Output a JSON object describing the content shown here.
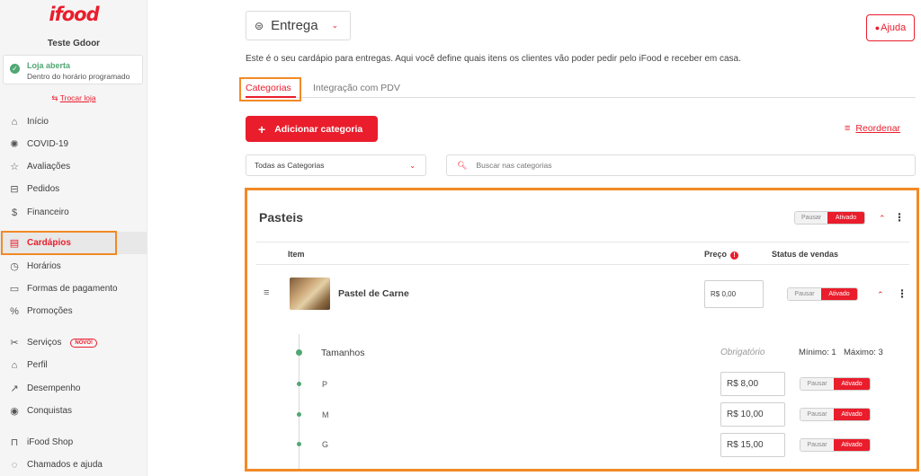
{
  "sidebar": {
    "brand": "ifood",
    "store_name": "Teste Gdoor",
    "status": {
      "title": "Loja aberta",
      "subtitle": "Dentro do horário programado",
      "color": "#50a773"
    },
    "switch_store": "Trocar loja",
    "items": [
      {
        "label": "Início",
        "icon": "home-icon"
      },
      {
        "label": "COVID-19",
        "icon": "virus-icon"
      },
      {
        "label": "Avaliações",
        "icon": "star-icon"
      },
      {
        "label": "Pedidos",
        "icon": "orders-icon"
      },
      {
        "label": "Financeiro",
        "icon": "dollar-icon"
      },
      {
        "label": "Cardápios",
        "icon": "menu-book-icon",
        "active": true
      },
      {
        "label": "Horários",
        "icon": "clock-icon"
      },
      {
        "label": "Formas de pagamento",
        "icon": "card-icon"
      },
      {
        "label": "Promoções",
        "icon": "percent-icon"
      },
      {
        "label": "Serviços",
        "icon": "services-icon",
        "badge": "NOVO!"
      },
      {
        "label": "Perfil",
        "icon": "store-icon"
      },
      {
        "label": "Desempenho",
        "icon": "chart-icon"
      },
      {
        "label": "Conquistas",
        "icon": "medal-icon"
      },
      {
        "label": "iFood Shop",
        "icon": "bag-icon"
      },
      {
        "label": "Chamados e ajuda",
        "icon": "chat-icon"
      }
    ]
  },
  "header": {
    "channel": "Entrega",
    "help": "Ajuda",
    "intro": "Este é o seu cardápio para entregas. Aqui você define quais itens os clientes vão poder pedir pelo iFood e receber em casa."
  },
  "tabs": [
    {
      "label": "Categorias",
      "active": true
    },
    {
      "label": "Integração com PDV",
      "active": false
    }
  ],
  "toolbar": {
    "add_category": "Adicionar categoria",
    "reorder": "Reordenar",
    "category_filter": "Todas as Categorias",
    "search_placeholder": "Buscar nas categorias"
  },
  "category": {
    "title": "Pasteis",
    "toggle": {
      "off": "Pausar",
      "on": "Ativado"
    },
    "columns": {
      "item": "Item",
      "price": "Preço",
      "status": "Status de vendas"
    },
    "item": {
      "name": "Pastel de Carne",
      "price": "R$ 0,00",
      "toggle": {
        "off": "Pausar",
        "on": "Ativado"
      },
      "group": {
        "title": "Tamanhos",
        "required": "Obrigatório",
        "min": "Mínimo: 1",
        "max": "Máximo: 3",
        "options": [
          {
            "name": "P",
            "price": "R$ 8,00",
            "off": "Pausar",
            "on": "Ativado"
          },
          {
            "name": "M",
            "price": "R$ 10,00",
            "off": "Pausar",
            "on": "Ativado"
          },
          {
            "name": "G",
            "price": "R$ 15,00",
            "off": "Pausar",
            "on": "Ativado"
          }
        ]
      }
    }
  },
  "colors": {
    "brand": "#ea1d2c",
    "highlight": "#f28a26",
    "success": "#50a773"
  }
}
